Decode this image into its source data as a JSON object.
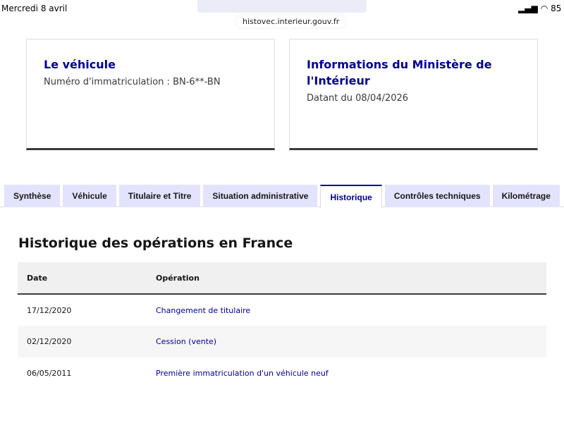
{
  "status_bar": {
    "date": "Mercredi 8 avril",
    "battery": "85"
  },
  "browser": {
    "url": "histovec.interieur.gouv.fr"
  },
  "cards": [
    {
      "title": "Le véhicule",
      "text": "Numéro d'immatriculation : BN-6**-BN"
    },
    {
      "title": "Informations du Ministère de l'Intérieur",
      "text": "Datant du 08/04/2026"
    }
  ],
  "tabs": [
    "Synthèse",
    "Véhicule",
    "Titulaire et Titre",
    "Situation administrative",
    "Historique",
    "Contrôles techniques",
    "Kilométrage"
  ],
  "panel": {
    "title": "Historique des opérations en France",
    "headers": [
      "Date",
      "Opération"
    ],
    "rows": [
      {
        "date": "17/12/2020",
        "operation": "Changement de titulaire"
      },
      {
        "date": "02/12/2020",
        "operation": "Cession (vente)"
      },
      {
        "date": "06/05/2011",
        "operation": "Première immatriculation d'un véhicule neuf"
      }
    ]
  }
}
